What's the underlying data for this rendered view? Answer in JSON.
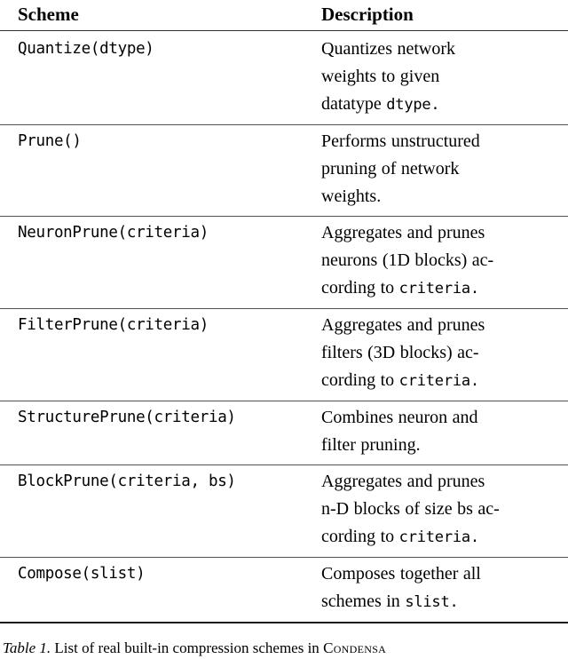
{
  "table": {
    "headers": {
      "scheme": "Scheme",
      "description": "Description"
    },
    "rows": [
      {
        "scheme": "Quantize(dtype)",
        "desc_lines": [
          "Quantizes network",
          "weights to given",
          "datatype "
        ],
        "desc_mono_tail": "dtype.",
        "desc_full": "Quantizes network weights to given datatype dtype."
      },
      {
        "scheme": "Prune()",
        "desc_lines": [
          "Performs unstructured",
          "pruning of network",
          "weights."
        ],
        "desc_mono_tail": "",
        "desc_full": "Performs unstructured pruning of network weights."
      },
      {
        "scheme": "NeuronPrune(criteria)",
        "desc_lines": [
          "Aggregates and prunes",
          "neurons (1D blocks) ac-",
          "cording to "
        ],
        "desc_mono_tail": "criteria.",
        "desc_full": "Aggregates and prunes neurons (1D blocks) according to criteria."
      },
      {
        "scheme": "FilterPrune(criteria)",
        "desc_lines": [
          "Aggregates and prunes",
          "filters (3D blocks) ac-",
          "cording to "
        ],
        "desc_mono_tail": "criteria.",
        "desc_full": "Aggregates and prunes filters (3D blocks) according to criteria."
      },
      {
        "scheme": "StructurePrune(criteria)",
        "desc_lines": [
          "Combines neuron and",
          "filter pruning."
        ],
        "desc_mono_tail": "",
        "desc_full": "Combines neuron and filter pruning."
      },
      {
        "scheme": "BlockPrune(criteria, bs)",
        "desc_lines": [
          "Aggregates and prunes",
          "n-D blocks of size bs ac-",
          "cording to "
        ],
        "desc_mono_tail": "criteria.",
        "desc_full": "Aggregates and prunes n-D blocks of size bs according to criteria."
      },
      {
        "scheme": "Compose(slist)",
        "desc_lines": [
          "Composes together all",
          "schemes in "
        ],
        "desc_mono_tail": "slist.",
        "desc_full": "Composes together all schemes in slist."
      }
    ]
  },
  "caption": {
    "label": "Table 1.",
    "text_before": " List of real built-in compression schemes in ",
    "library_name": "Condensa"
  }
}
